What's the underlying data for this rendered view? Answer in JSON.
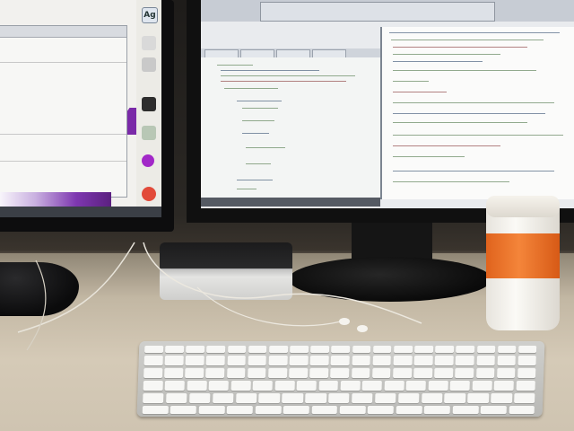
{
  "scene": {
    "description_elements": [
      "left-monitor",
      "right-monitor",
      "mac-mini",
      "keyboard",
      "coffee-cup",
      "earbuds"
    ],
    "colors": {
      "desk": "#d5cab7",
      "monitor_bezel": "#0d0d0e",
      "purple_accent": "#7a2aa8",
      "cup_sleeve": "#f4853a",
      "keyboard_keys": "#f7f7f5"
    }
  },
  "left_monitor": {
    "dock_label": "Ag"
  }
}
